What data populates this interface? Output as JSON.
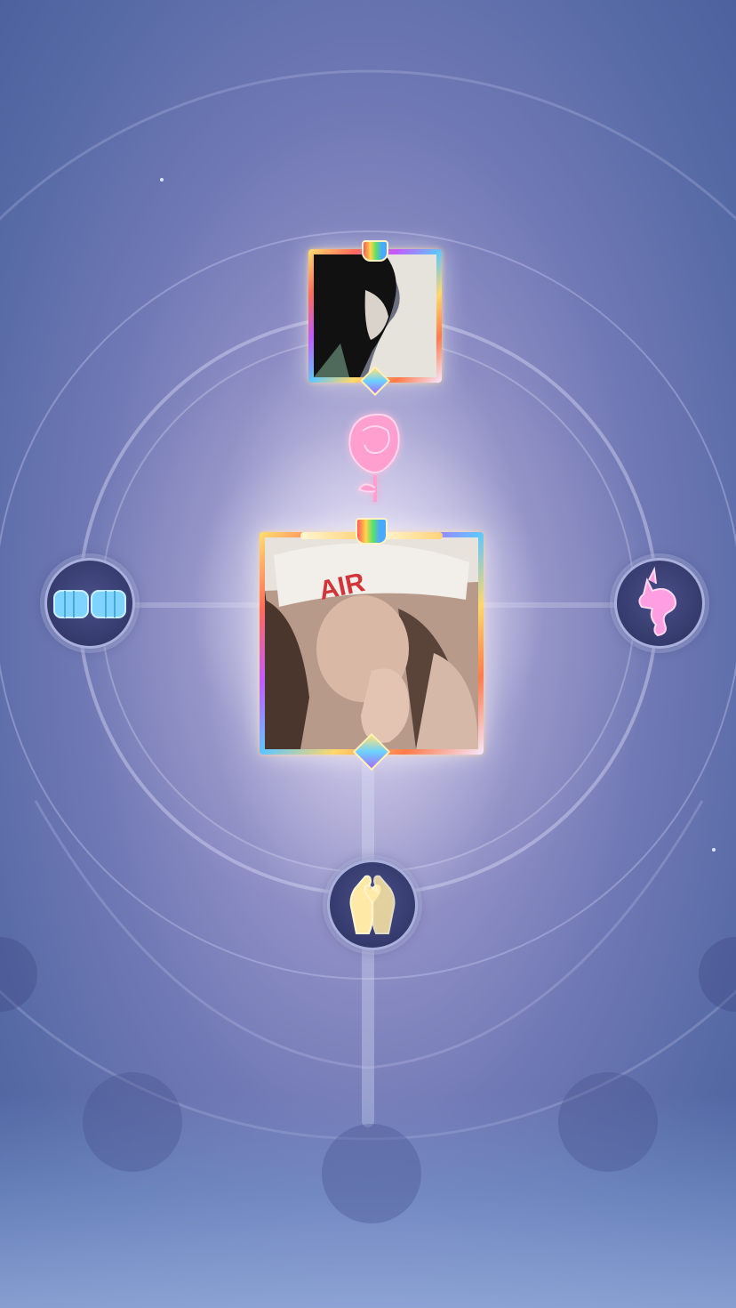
{
  "scene": {
    "title": "",
    "partner": {
      "avatar_label": "partner-avatar",
      "frame_style": "rainbow-gold"
    },
    "self": {
      "avatar_label": "self-avatar",
      "frame_style": "rainbow-gold"
    },
    "relation_icon": "rose-icon",
    "badges": [
      {
        "id": "fist-bump",
        "icon": "fist-bump-icon"
      },
      {
        "id": "unicorn",
        "icon": "unicorn-icon"
      },
      {
        "id": "high-five",
        "icon": "high-five-icon"
      }
    ],
    "empty_slots": 5
  },
  "colors": {
    "background_center": "#efeaf8",
    "background_edge": "#4a5f9c",
    "rose": "#ff8fc8",
    "fist": "#7fd4ff",
    "unicorn": "#ff9ee0",
    "hands": "#ffe9a6",
    "frame_gold": "#ffd86a"
  }
}
